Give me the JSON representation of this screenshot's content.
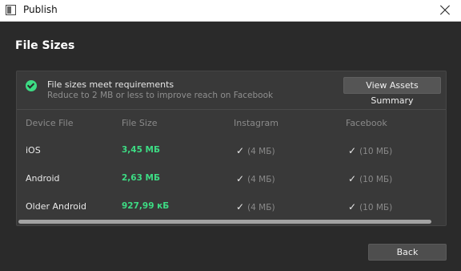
{
  "window": {
    "title": "Publish"
  },
  "heading": "File Sizes",
  "status": {
    "title": "File sizes meet requirements",
    "subtitle": "Reduce to 2 MB or less to improve reach on Facebook",
    "button_label": "View Assets Summary"
  },
  "table": {
    "headers": [
      "Device File",
      "File Size",
      "Instagram",
      "Facebook"
    ],
    "rows": [
      {
        "device": "iOS",
        "size": "3,45 МБ",
        "instagram": "(4 МБ)",
        "facebook": "(10 МБ)"
      },
      {
        "device": "Android",
        "size": "2,63 МБ",
        "instagram": "(4 МБ)",
        "facebook": "(10 МБ)"
      },
      {
        "device": "Older Android",
        "size": "927,99 кБ",
        "instagram": "(4 МБ)",
        "facebook": "(10 МБ)"
      }
    ]
  },
  "footer": {
    "back_label": "Back"
  },
  "colors": {
    "accent": "#3ddc84",
    "background": "#2a2a2a",
    "panel": "#393939"
  },
  "icons": {
    "status": "check-circle-icon",
    "requirement": "checkmark-icon",
    "close": "close-icon"
  }
}
